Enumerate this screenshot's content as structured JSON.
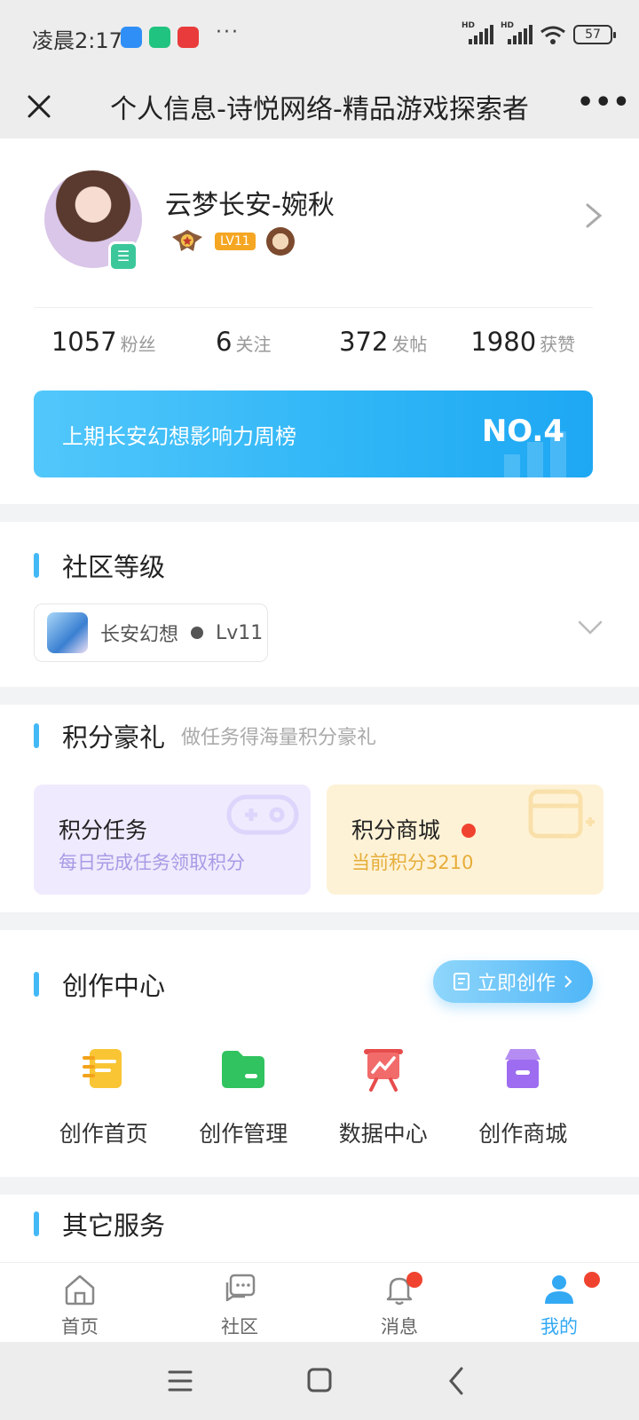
{
  "status_bar": {
    "time": "凌晨2:17",
    "more": "···",
    "signal_hd": "HD",
    "battery": "57"
  },
  "title_bar": {
    "title": "个人信息-诗悦网络-精品游戏探索者",
    "close_icon": "close-icon",
    "more": "•••"
  },
  "profile": {
    "name": "云梦长安-婉秋",
    "badge_char": "☰",
    "level_tag": "LV11",
    "stats": [
      {
        "num": "1057",
        "label": "粉丝"
      },
      {
        "num": "6",
        "label": "关注"
      },
      {
        "num": "372",
        "label": "发帖"
      },
      {
        "num": "1980",
        "label": "获赞"
      }
    ],
    "rank_text": "上期长安幻想影响力周榜",
    "rank_no": "NO.4",
    "colors": {
      "rank_start": "#52c7fb",
      "rank_end": "#1ea7f3"
    }
  },
  "community_level": {
    "title": "社区等级",
    "game": "长安幻想",
    "level": "Lv11"
  },
  "points": {
    "title": "积分豪礼",
    "subtitle": "做任务得海量积分豪礼",
    "task": {
      "title": "积分任务",
      "desc": "每日完成任务领取积分"
    },
    "shop": {
      "title": "积分商城",
      "desc": "当前积分3210"
    }
  },
  "creation": {
    "title": "创作中心",
    "button": "立即创作",
    "items": [
      {
        "label": "创作首页",
        "icon": "notebook-icon"
      },
      {
        "label": "创作管理",
        "icon": "folder-icon"
      },
      {
        "label": "数据中心",
        "icon": "chart-board-icon"
      },
      {
        "label": "创作商城",
        "icon": "store-icon"
      }
    ]
  },
  "other": {
    "title": "其它服务"
  },
  "bottom_nav": [
    {
      "label": "首页",
      "icon": "home-icon"
    },
    {
      "label": "社区",
      "icon": "chat-icon"
    },
    {
      "label": "消息",
      "icon": "bell-icon"
    },
    {
      "label": "我的",
      "icon": "user-icon"
    }
  ],
  "accent_color": "#43b8f7"
}
